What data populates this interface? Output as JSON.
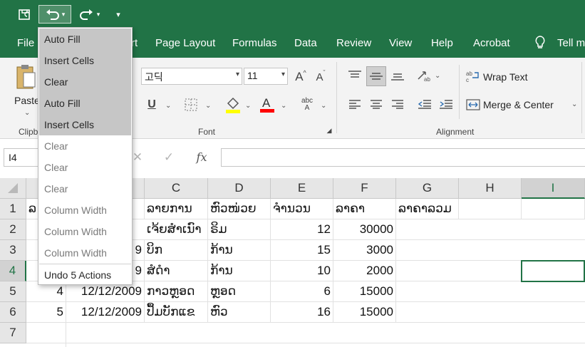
{
  "quick_access": {
    "redo_arrow": "↷",
    "customize": "▾"
  },
  "tabs": [
    "File",
    "rt",
    "Page Layout",
    "Formulas",
    "Data",
    "Review",
    "View",
    "Help",
    "Acrobat",
    "Tell m"
  ],
  "ribbon": {
    "clipboard": {
      "paste_label": "Paste",
      "group_label": "Clipb"
    },
    "font": {
      "font_name": "고딕",
      "font_size": "11",
      "grow_label": "A",
      "shrink_label": "A",
      "underline_label": "U",
      "group_label": "Font",
      "highlight_color": "#ffff00",
      "font_color": "#ff0000"
    },
    "alignment": {
      "wrap_text": "Wrap Text",
      "merge_center": "Merge & Center",
      "group_label": "Alignment"
    }
  },
  "formula_bar": {
    "name_box": "I4",
    "fx": "fx",
    "cancel_glyph": "✕",
    "enter_glyph": "✓"
  },
  "undo_menu": {
    "items": [
      {
        "label": "Auto Fill",
        "state": "selected"
      },
      {
        "label": "Insert Cells",
        "state": "selected"
      },
      {
        "label": "Clear",
        "state": "selected"
      },
      {
        "label": "Auto Fill",
        "state": "selected"
      },
      {
        "label": "Insert Cells",
        "state": "selected"
      },
      {
        "label": "Clear",
        "state": "normal"
      },
      {
        "label": "Clear",
        "state": "normal"
      },
      {
        "label": "Clear",
        "state": "normal"
      },
      {
        "label": "Column Width",
        "state": "normal"
      },
      {
        "label": "Column Width",
        "state": "normal"
      },
      {
        "label": "Column Width",
        "state": "normal"
      }
    ],
    "footer": "Undo 5 Actions"
  },
  "sheet": {
    "columns": [
      "C",
      "D",
      "E",
      "F",
      "G",
      "H",
      "I"
    ],
    "rows": [
      "1",
      "2",
      "3",
      "4",
      "5",
      "6",
      "7"
    ],
    "selected_cell": "I4",
    "cells": {
      "r1": {
        "a": "ລ",
        "c": "ລາຍການ",
        "d": "ຫົວໜ່ວຍ",
        "e": "ຈຳນວນ",
        "f": "ລາຄາ",
        "g": "ລາຄາລວມ"
      },
      "r2": {
        "c": "ເຈ້ຍສຳເນົາ",
        "d": "ຣິມ",
        "e": "12",
        "f": "30000"
      },
      "r3": {
        "b_tail": "9",
        "c": "ບິກ",
        "d": "ກ້ານ",
        "e": "15",
        "f": "3000"
      },
      "r4": {
        "b_tail": "9",
        "c": "ສໍດຳ",
        "d": "ກ້ານ",
        "e": "10",
        "f": "2000"
      },
      "r5": {
        "a": "4",
        "b": "12/12/2009",
        "c": "ກາວຫຼອດ",
        "d": "ຫຼອດ",
        "e": "6",
        "f": "15000"
      },
      "r6": {
        "a": "5",
        "b": "12/12/2009",
        "c": "ປຶ້ມບັກແຂ",
        "d": "ຫົວ",
        "e": "16",
        "f": "15000"
      }
    }
  }
}
